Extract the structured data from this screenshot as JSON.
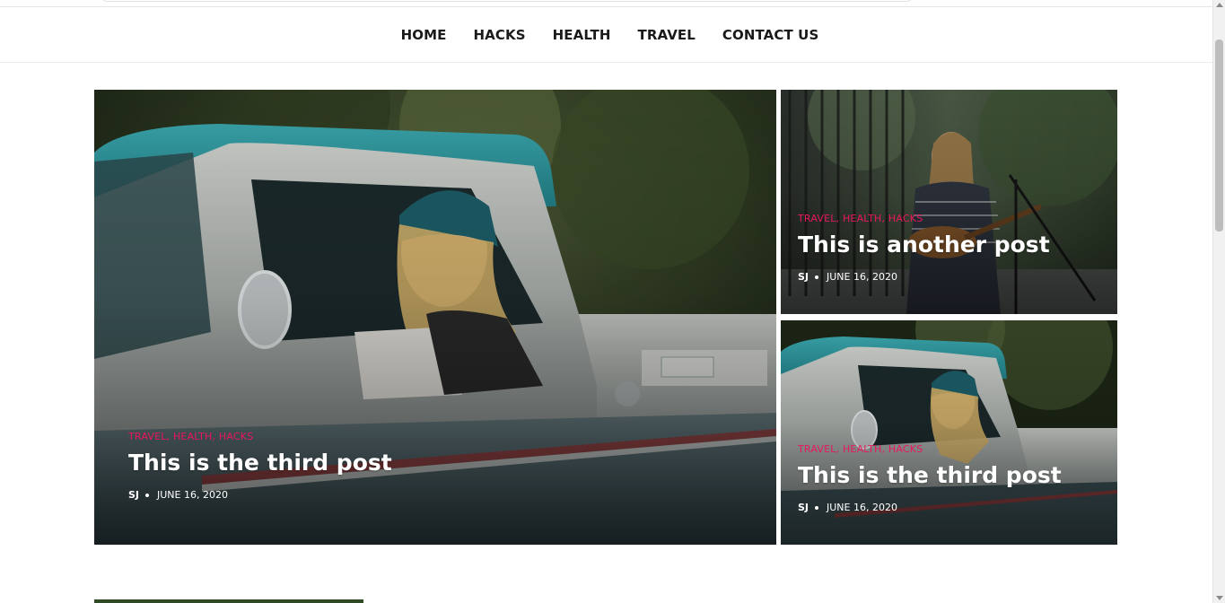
{
  "nav": {
    "items": [
      {
        "label": "HOME"
      },
      {
        "label": "HACKS"
      },
      {
        "label": "HEALTH"
      },
      {
        "label": "TRAVEL"
      },
      {
        "label": "CONTACT US"
      }
    ]
  },
  "posts": [
    {
      "categories": [
        "TRAVEL",
        "HEALTH",
        "HACKS"
      ],
      "title": "This is the third post",
      "author": "SJ",
      "date": "JUNE 16, 2020"
    },
    {
      "categories": [
        "TRAVEL",
        "HEALTH",
        "HACKS"
      ],
      "title": "This is another post",
      "author": "SJ",
      "date": "JUNE 16, 2020"
    },
    {
      "categories": [
        "TRAVEL",
        "HEALTH",
        "HACKS"
      ],
      "title": "This is the third post",
      "author": "SJ",
      "date": "JUNE 16, 2020"
    }
  ],
  "colors": {
    "category_accent": "#e8175d",
    "nav_text": "#1a1a1a"
  }
}
